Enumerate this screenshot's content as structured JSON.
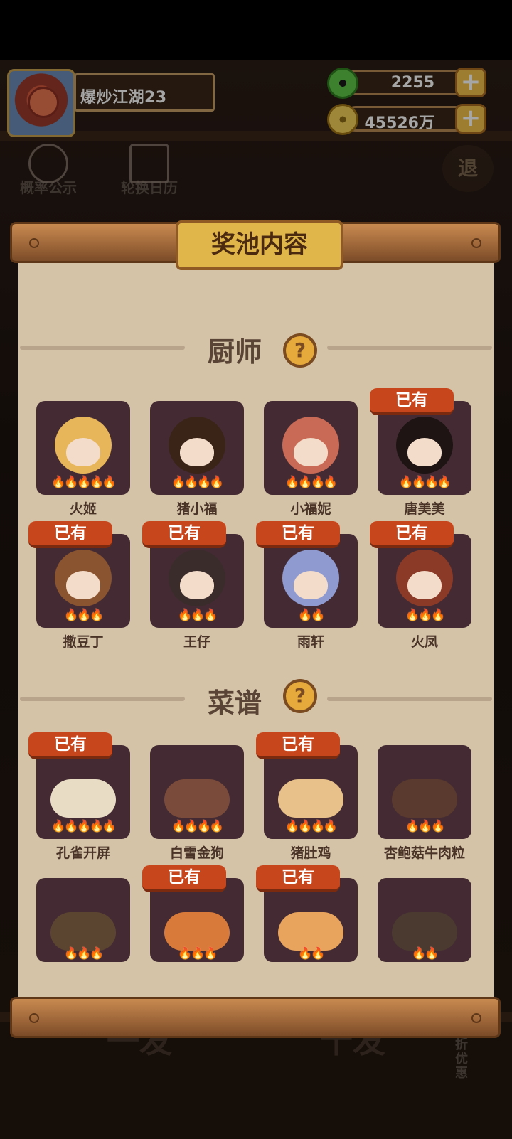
{
  "header": {
    "player_name": "爆炒江湖23",
    "jade_amount": "2255",
    "coin_amount": "45526万",
    "plus_label": "+"
  },
  "background": {
    "prob_label": "概率公示",
    "rotation_label": "轮换日历",
    "exit_label": "退",
    "bottom_left": "一发",
    "bottom_right": "十发",
    "side_promo": "九折优惠"
  },
  "panel": {
    "title": "奖池内容",
    "owned_label": "已有",
    "chef_section": "厨师",
    "recipe_section": "菜谱",
    "help_label": "?"
  },
  "chefs": [
    {
      "name": "火姬",
      "flames": "🔥🔥🔥🔥🔥",
      "owned": false
    },
    {
      "name": "猪小福",
      "flames": "🔥🔥🔥🔥",
      "owned": false
    },
    {
      "name": "小福妮",
      "flames": "🔥🔥🔥🔥",
      "owned": false
    },
    {
      "name": "唐美美",
      "flames": "🔥🔥🔥🔥",
      "owned": true
    },
    {
      "name": "撒豆丁",
      "flames": "🔥🔥🔥",
      "owned": true
    },
    {
      "name": "王仔",
      "flames": "🔥🔥🔥",
      "owned": true
    },
    {
      "name": "雨轩",
      "flames": "🔥🔥",
      "owned": true
    },
    {
      "name": "火凤",
      "flames": "🔥🔥🔥",
      "owned": true
    }
  ],
  "recipes": [
    {
      "name": "孔雀开屏",
      "flames": "🔥🔥🔥🔥🔥",
      "owned": true
    },
    {
      "name": "白雪金狗",
      "flames": "🔥🔥🔥🔥",
      "owned": false
    },
    {
      "name": "猪肚鸡",
      "flames": "🔥🔥🔥🔥",
      "owned": true
    },
    {
      "name": "杏鲍菇牛肉粒",
      "flames": "🔥🔥🔥",
      "owned": false
    },
    {
      "name": "",
      "flames": "🔥🔥🔥",
      "owned": false
    },
    {
      "name": "",
      "flames": "🔥🔥🔥",
      "owned": true
    },
    {
      "name": "",
      "flames": "🔥🔥",
      "owned": true
    },
    {
      "name": "",
      "flames": "🔥🔥",
      "owned": false
    }
  ],
  "colors": {
    "paper": "#d5c3a8",
    "card": "#442b33",
    "owned_badge": "#c8461b",
    "title_plate": "#e0b64b"
  }
}
